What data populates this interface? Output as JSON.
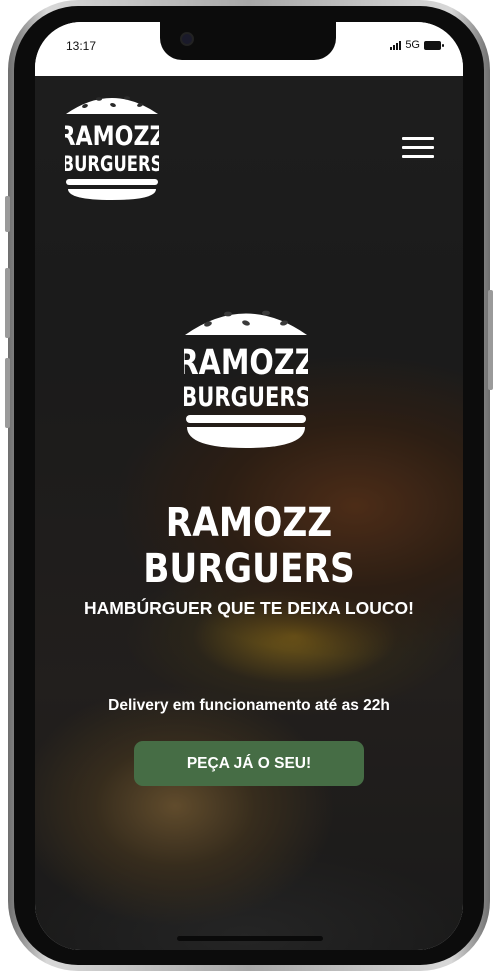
{
  "status_bar": {
    "time": "13:17",
    "network": "5G"
  },
  "nav": {
    "logo_line1": "RAMOZZ",
    "logo_line2": "BURGUERS",
    "menu_icon": "hamburger-menu-icon"
  },
  "hero": {
    "logo_line1": "RAMOZZ",
    "logo_line2": "BURGUERS",
    "title": "RAMOZZ BURGUERS",
    "subtitle": "HAMBÚRGUER QUE TE DEIXA LOUCO!",
    "delivery_text": "Delivery em funcionamento até as 22h",
    "cta_label": "PEÇA JÁ O SEU!"
  },
  "colors": {
    "accent": "#466d45",
    "hero_overlay": "#1f1f1f",
    "text": "#ffffff"
  }
}
